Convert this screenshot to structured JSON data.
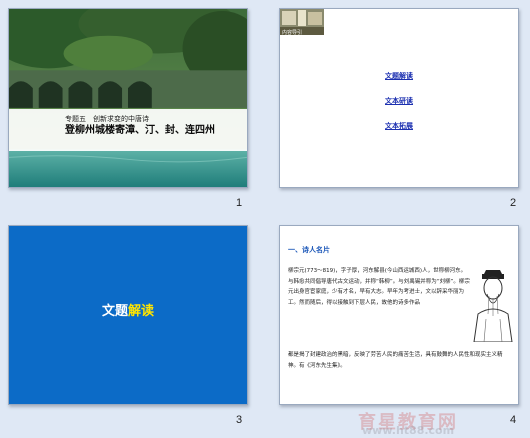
{
  "slides": [
    {
      "number": "1",
      "subtitle": "专题五　创新求变的中唐诗",
      "title": "登柳州城楼寄漳、汀、封、连四州"
    },
    {
      "number": "2",
      "thumb_label": "内容导引",
      "links": [
        "文题解读",
        "文本研读",
        "文本拓展"
      ]
    },
    {
      "number": "3",
      "heading_part1": "文题",
      "heading_part2": "解读"
    },
    {
      "number": "4",
      "section_heading": "一、诗人名片",
      "para1": "柳宗元(773～819)，字子厚，河东解县(今山西运城西)人，世称柳河东。与韩愈共同倡导唐代古文运动，并称“韩柳”。与刘禹锡并称为“刘柳”。柳宗元出身官宦家庭，少有才名，早有大志。早年为考进士，文以辞采华丽为工。然而随后，得以接触到下层人民，故他的诗多作品",
      "para2": "都是揭了封建政治的黑暗，反映了劳苦人民的痛苦生活，具有鼓舞的人民性和现实主义精神。有《河东先生集》。"
    }
  ],
  "watermark": {
    "text": "育星教育网",
    "url": "www.ht88.com"
  }
}
